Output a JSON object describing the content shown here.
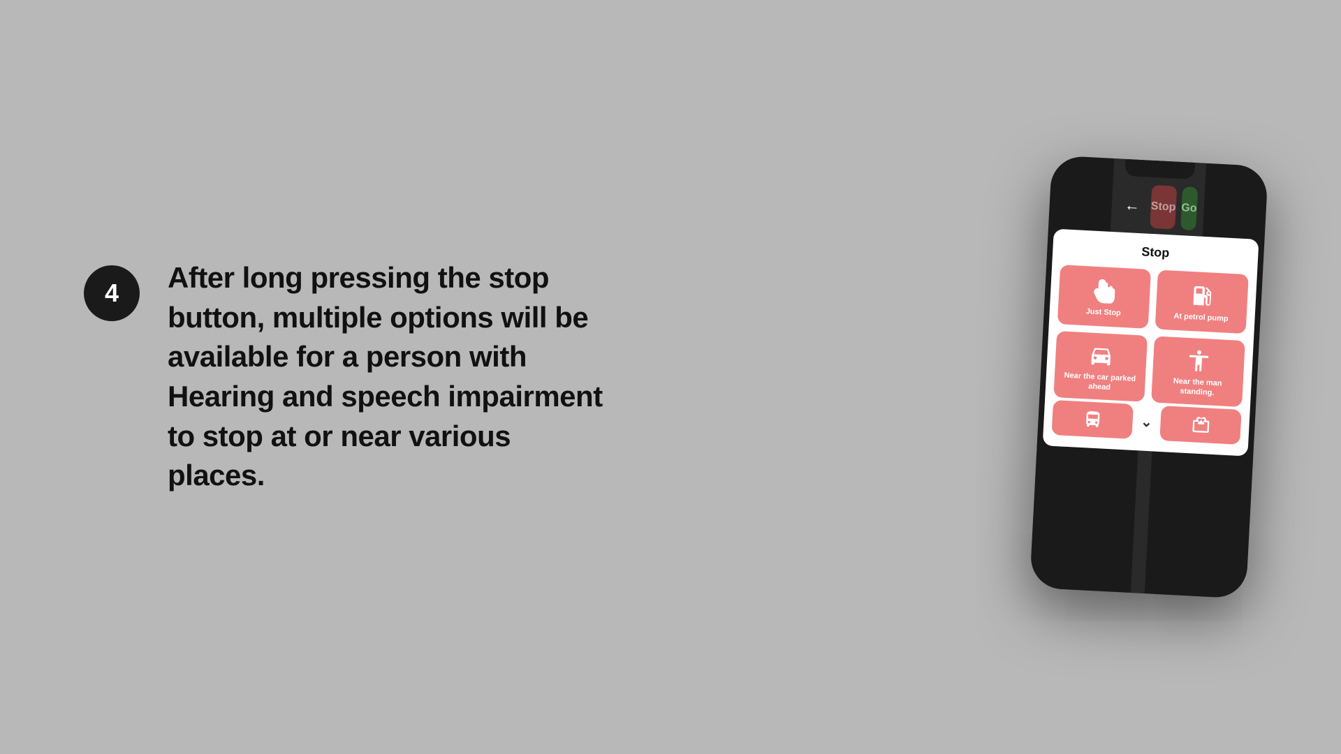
{
  "background_color": "#b8b8b8",
  "step": {
    "number": "4",
    "badge_color": "#1a1a1a"
  },
  "description": "After long pressing the stop button, multiple options will be available for a person with Hearing and speech impairment to stop at or near various places.",
  "phone": {
    "back_button": "←",
    "top_stop_label": "Stop",
    "top_go_label": "Go",
    "modal": {
      "title": "Stop",
      "options": [
        {
          "label": "Just Stop",
          "icon": "hand"
        },
        {
          "label": "At petrol pump",
          "icon": "fuel"
        },
        {
          "label": "Near the car parked ahead",
          "icon": "car"
        },
        {
          "label": "Near the man standing.",
          "icon": "person"
        },
        {
          "label": "",
          "icon": "bus"
        },
        {
          "label": "",
          "icon": "sign"
        }
      ]
    }
  }
}
